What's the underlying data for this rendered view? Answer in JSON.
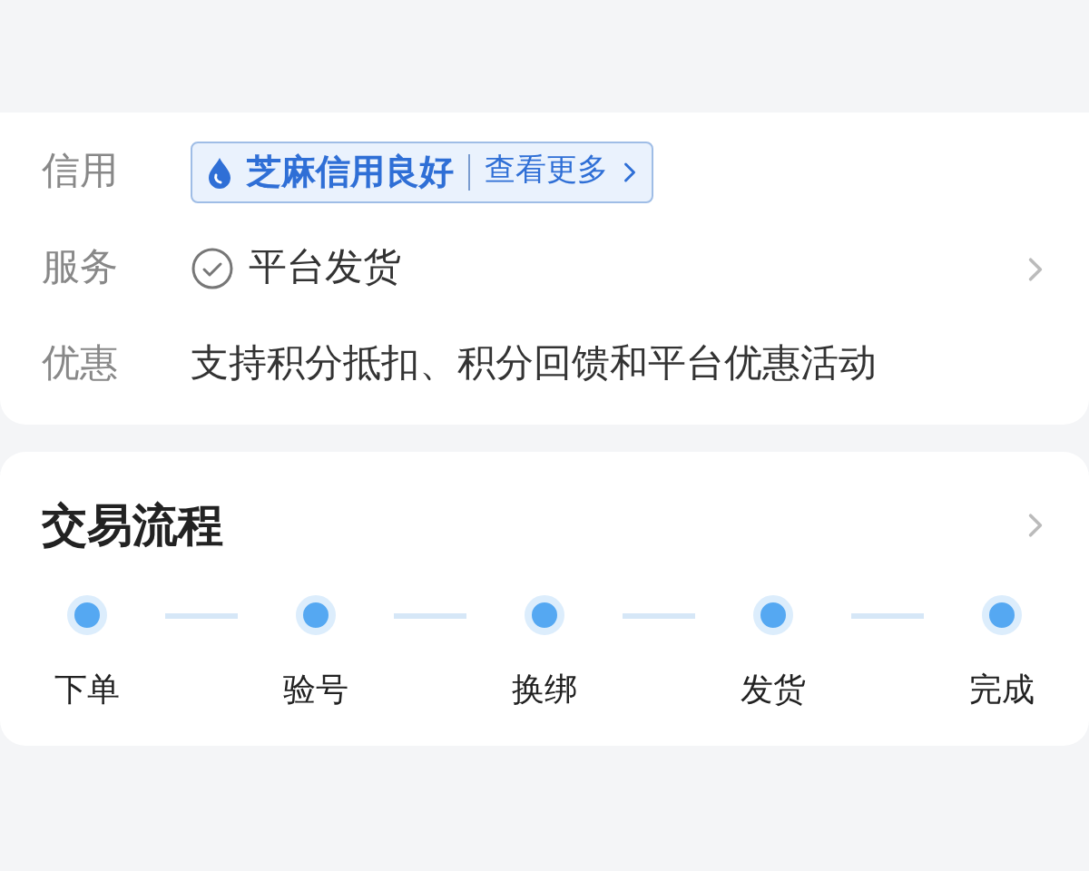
{
  "info_rows": [
    {
      "kind": "credit",
      "label": "信用",
      "badge_text": "芝麻信用良好",
      "badge_link": "查看更多"
    },
    {
      "kind": "service",
      "label": "服务",
      "value": "平台发货"
    },
    {
      "kind": "text",
      "label": "优惠",
      "value": "支持积分抵扣、积分回馈和平台优惠活动"
    }
  ],
  "process": {
    "title": "交易流程",
    "steps": [
      {
        "label": "下单"
      },
      {
        "label": "验号"
      },
      {
        "label": "换绑"
      },
      {
        "label": "发货"
      },
      {
        "label": "完成"
      }
    ]
  }
}
